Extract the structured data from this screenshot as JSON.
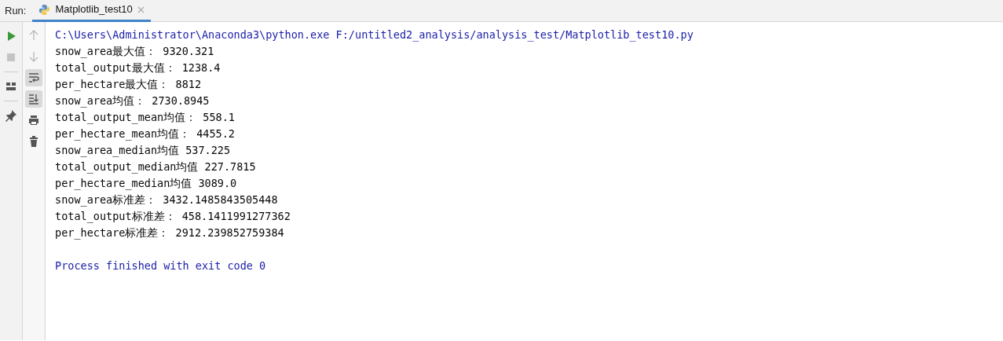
{
  "run_label": "Run:",
  "tabs": [
    {
      "label": "Matplotlib_test10",
      "selected": true
    }
  ],
  "left_tools": [
    {
      "kind": "run",
      "disabled": false
    },
    {
      "kind": "stop",
      "disabled": true
    },
    {
      "kind": "layout",
      "disabled": false
    },
    {
      "kind": "pin",
      "disabled": false
    }
  ],
  "console_tools": [
    {
      "kind": "up",
      "disabled": true,
      "on": false
    },
    {
      "kind": "down",
      "disabled": true,
      "on": false
    },
    {
      "kind": "wrap",
      "disabled": false,
      "on": true
    },
    {
      "kind": "scroll-end",
      "disabled": false,
      "on": true
    },
    {
      "kind": "print",
      "disabled": false,
      "on": false
    },
    {
      "kind": "trash",
      "disabled": false,
      "on": false
    }
  ],
  "console_lines": [
    {
      "kind": "command",
      "text": "C:\\Users\\Administrator\\Anaconda3\\python.exe F:/untitled2_analysis/analysis_test/Matplotlib_test10.py"
    },
    {
      "kind": "output",
      "text": "snow_area最大值： 9320.321"
    },
    {
      "kind": "output",
      "text": "total_output最大值： 1238.4"
    },
    {
      "kind": "output",
      "text": "per_hectare最大值： 8812"
    },
    {
      "kind": "output",
      "text": "snow_area均值： 2730.8945"
    },
    {
      "kind": "output",
      "text": "total_output_mean均值： 558.1"
    },
    {
      "kind": "output",
      "text": "per_hectare_mean均值： 4455.2"
    },
    {
      "kind": "output",
      "text": "snow_area_median均值 537.225"
    },
    {
      "kind": "output",
      "text": "total_output_median均值 227.7815"
    },
    {
      "kind": "output",
      "text": "per_hectare_median均值 3089.0"
    },
    {
      "kind": "output",
      "text": "snow_area标准差： 3432.1485843505448"
    },
    {
      "kind": "output",
      "text": "total_output标准差： 458.1411991277362"
    },
    {
      "kind": "output",
      "text": "per_hectare标准差： 2912.239852759384"
    },
    {
      "kind": "exit",
      "text": "Process finished with exit code 0"
    }
  ]
}
